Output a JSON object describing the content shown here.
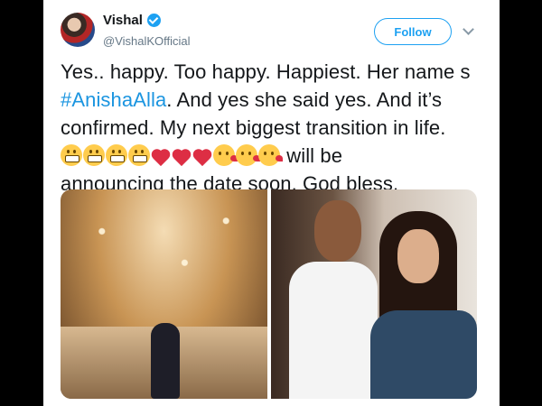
{
  "user": {
    "name": "Vishal",
    "handle": "@VishalKOfficial",
    "verified": true,
    "follow_label": "Follow"
  },
  "tweet": {
    "line1": "Yes.. happy. Too happy.  Happiest. Her name s",
    "hashtag": "#AnishaAlla",
    "line2_rest": ". And yes she said yes. And it’s",
    "line3": "confirmed. My next biggest transition in life.",
    "emoji_sequence": [
      "grimacing-face",
      "grimacing-face",
      "grimacing-face",
      "grimacing-face",
      "red-heart",
      "red-heart",
      "red-heart",
      "kissing-face",
      "kissing-face",
      "kissing-face"
    ],
    "line4_rest": " will be",
    "line5": "announcing the date soon. God bless."
  },
  "colors": {
    "accent": "#1da1f2",
    "hashtag": "#1b95e0",
    "text": "#14171a",
    "muted": "#657786"
  }
}
